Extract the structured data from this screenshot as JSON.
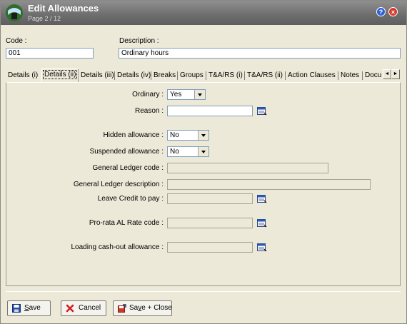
{
  "window": {
    "title": "Edit Allowances",
    "subtitle": "Page 2 / 12",
    "help_glyph": "?",
    "close_glyph": "×"
  },
  "header": {
    "code_label": "Code :",
    "code_value": "001",
    "description_label": "Description :",
    "description_value": "Ordinary hours"
  },
  "tabs": [
    {
      "label": "Details (i)"
    },
    {
      "label": "Details (ii)",
      "active": true
    },
    {
      "label": "Details (iii)"
    },
    {
      "label": "Details (iv)"
    },
    {
      "label": "Breaks"
    },
    {
      "label": "Groups"
    },
    {
      "label": "T&A/RS (i)"
    },
    {
      "label": "T&A/RS (ii)"
    },
    {
      "label": "Action Clauses"
    },
    {
      "label": "Notes"
    },
    {
      "label": "Docu"
    }
  ],
  "tab_scroll": {
    "left": "◄",
    "right": "►"
  },
  "form": {
    "ordinary_label": "Ordinary :",
    "ordinary_value": "Yes",
    "reason_label": "Reason :",
    "reason_value": "",
    "hidden_label": "Hidden allowance :",
    "hidden_value": "No",
    "suspended_label": "Suspended allowance :",
    "suspended_value": "No",
    "gl_code_label": "General Ledger code :",
    "gl_code_value": "",
    "gl_desc_label": "General Ledger description :",
    "gl_desc_value": "",
    "leave_credit_label": "Leave Credit to pay :",
    "leave_credit_value": "",
    "prorata_label": "Pro-rata AL Rate code :",
    "prorata_value": "",
    "loading_label": "Loading cash-out allowance :",
    "loading_value": ""
  },
  "buttons": {
    "save_prefix": "",
    "save_mnemonic": "S",
    "save_rest": "ave",
    "cancel": "Cancel",
    "save_close_prefix": "Sa",
    "save_close_mnemonic": "v",
    "save_close_rest": "e + Close"
  },
  "colors": {
    "titlebar": "#6d6d6d",
    "window_bg": "#ece9d8",
    "input_border": "#7f9db9",
    "cancel_x": "#d02020",
    "help_blue": "#2d5fd0"
  },
  "icons": {
    "app": "app-logo-icon",
    "lookup": "lookup-calendar-icon",
    "save": "floppy-disk-icon",
    "cancel": "red-x-icon",
    "save_close": "save-close-icon"
  }
}
